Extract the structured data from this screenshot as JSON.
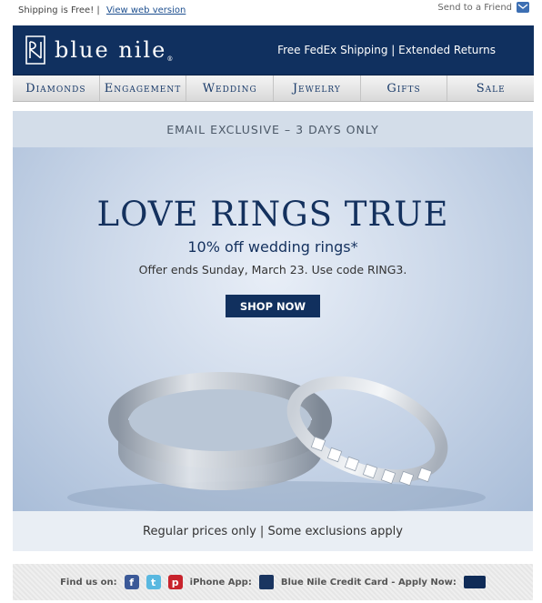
{
  "topbar": {
    "shipping_text": "Shipping is Free! |",
    "web_version_link": "View web version",
    "send_friend": "Send to a Friend"
  },
  "header": {
    "brand": "blue nile",
    "brand_mark": "®",
    "promo": "Free FedEx Shipping  |  Extended Returns"
  },
  "nav": {
    "items": [
      "Diamonds",
      "Engagement",
      "Wedding",
      "Jewelry",
      "Gifts",
      "Sale"
    ]
  },
  "hero": {
    "band": "EMAIL EXCLUSIVE – 3 DAYS ONLY",
    "title": "LOVE RINGS TRUE",
    "subtitle": "10% off wedding rings*",
    "offer": "Offer ends Sunday, March 23. Use code RING3.",
    "cta": "SHOP NOW",
    "footnote": "Regular prices only | Some exclusions apply"
  },
  "footer": {
    "find_us": "Find us on:",
    "iphone_app": "iPhone App:",
    "credit_card": "Blue Nile Credit Card - Apply Now:",
    "icons": [
      "facebook-icon",
      "twitter-icon",
      "pinterest-icon"
    ]
  },
  "colors": {
    "navy": "#10305f",
    "hero_bg": "#dfe7f1",
    "cta_bg": "#11305e"
  }
}
